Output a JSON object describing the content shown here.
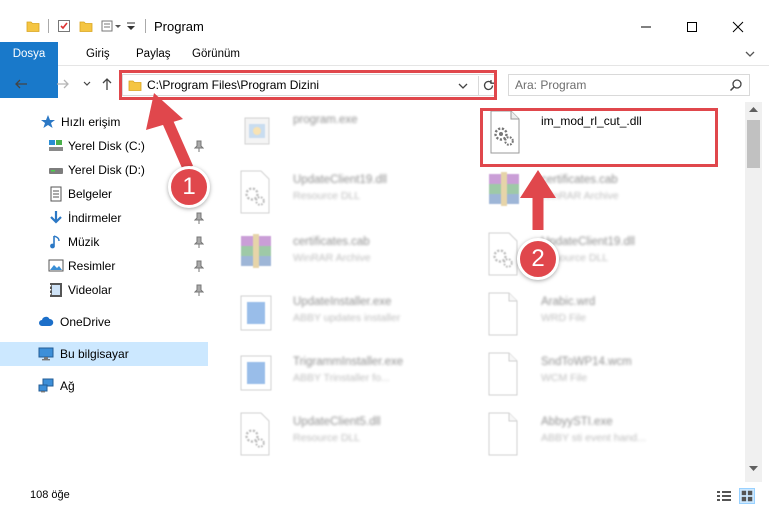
{
  "window": {
    "title": "Program",
    "minimize_icon": "minimize-icon",
    "maximize_icon": "maximize-icon",
    "close_icon": "close-icon"
  },
  "ribbon": {
    "tabs": [
      {
        "label": "Dosya"
      },
      {
        "label": "Giriş"
      },
      {
        "label": "Paylaş"
      },
      {
        "label": "Görünüm"
      }
    ],
    "accent": "#1979ca"
  },
  "address": {
    "path": "C:\\Program Files\\Program Dizini"
  },
  "search": {
    "placeholder": "Ara: Program"
  },
  "sidebar": {
    "items": [
      {
        "label": "Hızlı erişim",
        "icon": "star-icon",
        "pinned": false
      },
      {
        "label": "Yerel Disk (C:)",
        "icon": "drive-icon",
        "pinned": true
      },
      {
        "label": "Yerel Disk (D:)",
        "icon": "drive-icon",
        "pinned": false
      },
      {
        "label": "Belgeler",
        "icon": "documents-icon",
        "pinned": false
      },
      {
        "label": "İndirmeler",
        "icon": "download-icon",
        "pinned": true
      },
      {
        "label": "Müzik",
        "icon": "music-icon",
        "pinned": true
      },
      {
        "label": "Resimler",
        "icon": "pictures-icon",
        "pinned": true
      },
      {
        "label": "Videolar",
        "icon": "video-icon",
        "pinned": true
      },
      {
        "label": "OneDrive",
        "icon": "cloud-icon",
        "pinned": false
      },
      {
        "label": "Bu bilgisayar",
        "icon": "computer-icon",
        "pinned": false,
        "selected": true
      },
      {
        "label": "Ağ",
        "icon": "network-icon",
        "pinned": false
      }
    ]
  },
  "files": [
    {
      "name": "program.exe",
      "type": "",
      "icon": "exe-icon"
    },
    {
      "name": "im_mod_rl_cut_.dll",
      "type": "",
      "icon": "dll-gear-icon"
    },
    {
      "name": "UpdateClient19.dll",
      "type": "Resource DLL",
      "icon": "dll-gear-icon"
    },
    {
      "name": "certificates.cab",
      "type": "WinRAR Archive",
      "icon": "winrar-icon"
    },
    {
      "name": "certificates.cab",
      "type": "WinRAR Archive",
      "icon": "winrar-icon"
    },
    {
      "name": "UpdateClient19.dll",
      "type": "Resource DLL",
      "icon": "dll-gear-icon"
    },
    {
      "name": "UpdateInstaller.exe",
      "type": "ABBY updates installer",
      "icon": "installer-icon"
    },
    {
      "name": "Arabic.wrd",
      "type": "WRD File",
      "icon": "blank-file-icon"
    },
    {
      "name": "TrigrammInstaller.exe",
      "type": "ABBY Trinstaller fo...",
      "icon": "installer-icon"
    },
    {
      "name": "SndToWP14.wcm",
      "type": "WCM File",
      "icon": "blank-file-icon"
    },
    {
      "name": "UpdateClient5.dll",
      "type": "Resource DLL",
      "icon": "dll-gear-icon"
    },
    {
      "name": "AbbyySTI.exe",
      "type": "ABBY sti event hand...",
      "icon": "blank-file-icon"
    }
  ],
  "status": {
    "count": "108 öğe"
  },
  "annotations": {
    "callouts": [
      "1",
      "2"
    ],
    "color": "#e0474c"
  }
}
